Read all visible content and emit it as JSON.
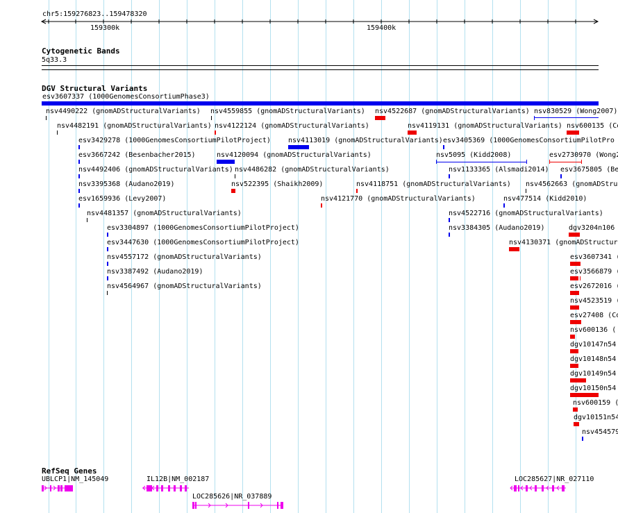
{
  "ruler": {
    "range_label": "chr5:159276823..159478320",
    "ticks": [
      "159300k",
      "159400k"
    ]
  },
  "cytoband": {
    "title": "Cytogenetic Bands",
    "band": "5q33.3"
  },
  "dgv": {
    "title": "DGV Structural Variants",
    "top_label": "esv3607337 (1000GenomesConsortiumPhase3)",
    "items": [
      {
        "id": "nsv4490222",
        "text": "nsv4490222 (gnomADStructuralVariants)",
        "color": "#000000"
      },
      {
        "id": "nsv4559855",
        "text": "nsv4559855 (gnomADStructuralVariants)",
        "color": "#000000"
      },
      {
        "id": "nsv4522687",
        "text": "nsv4522687 (gnomADStructuralVariants)",
        "color": "#ee0000"
      },
      {
        "id": "nsv830529",
        "text": "nsv830529 (Wong2007)",
        "color": "#0000ee"
      },
      {
        "id": "nsv4482191",
        "text": "nsv4482191 (gnomADStructuralVariants)",
        "color": "#000000"
      },
      {
        "id": "nsv4122124",
        "text": "nsv4122124 (gnomADStructuralVariants)",
        "color": "#ee0000"
      },
      {
        "id": "nsv4119131",
        "text": "nsv4119131 (gnomADStructuralVariants)",
        "color": "#ee0000"
      },
      {
        "id": "nsv600135",
        "text": "nsv600135 (Co",
        "color": "#ee0000"
      },
      {
        "id": "esv3429278",
        "text": "esv3429278 (1000GenomesConsortiumPilotProject)",
        "color": "#0000ee"
      },
      {
        "id": "nsv4113019",
        "text": "nsv4113019 (gnomADStructuralVariants)",
        "color": "#0000ee"
      },
      {
        "id": "esv3405369",
        "text": "esv3405369 (1000GenomesConsortiumPilotPro",
        "color": "#0000ee"
      },
      {
        "id": "esv3667242",
        "text": "esv3667242 (Besenbacher2015)",
        "color": "#0000ee"
      },
      {
        "id": "nsv4120094",
        "text": "nsv4120094 (gnomADStructuralVariants)",
        "color": "#0000ee"
      },
      {
        "id": "nsv5095",
        "text": "nsv5095 (Kidd2008)",
        "color": "#0000ee"
      },
      {
        "id": "esv2730970",
        "text": "esv2730970 (Wong2",
        "color": "#ee0000"
      },
      {
        "id": "nsv4492406",
        "text": "nsv4492406 (gnomADStructuralVariants)",
        "color": "#0000ee"
      },
      {
        "id": "nsv4486282",
        "text": "nsv4486282 (gnomADStructuralVariants)",
        "color": "#000000"
      },
      {
        "id": "nsv1133365",
        "text": "nsv1133365 (Alsmadi2014)",
        "color": "#0000ee"
      },
      {
        "id": "esv3675805",
        "text": "esv3675805 (Be",
        "color": "#0000ee"
      },
      {
        "id": "nsv3395368",
        "text": "nsv3395368 (Audano2019)",
        "color": "#0000ee"
      },
      {
        "id": "nsv522395",
        "text": "nsv522395 (Shaikh2009)",
        "color": "#ee0000"
      },
      {
        "id": "nsv4118751",
        "text": "nsv4118751 (gnomADStructuralVariants)",
        "color": "#ee0000"
      },
      {
        "id": "nsv4562663",
        "text": "nsv4562663 (gnomADStru",
        "color": "#000000"
      },
      {
        "id": "esv1659936",
        "text": "esv1659936 (Levy2007)",
        "color": "#0000ee"
      },
      {
        "id": "nsv4121770",
        "text": "nsv4121770 (gnomADStructuralVariants)",
        "color": "#ee0000"
      },
      {
        "id": "nsv477514",
        "text": "nsv477514 (Kidd2010)",
        "color": "#0000ee"
      },
      {
        "id": "nsv4481357",
        "text": "nsv4481357 (gnomADStructuralVariants)",
        "color": "#000000"
      },
      {
        "id": "nsv4522716",
        "text": "nsv4522716 (gnomADStructuralVariants)",
        "color": "#0000ee"
      },
      {
        "id": "esv3304897",
        "text": "esv3304897 (1000GenomesConsortiumPilotProject)",
        "color": "#0000ee"
      },
      {
        "id": "nsv3384305",
        "text": "nsv3384305 (Audano2019)",
        "color": "#0000ee"
      },
      {
        "id": "dgv3204n106",
        "text": "dgv3204n106",
        "color": "#ee0000"
      },
      {
        "id": "esv3447630",
        "text": "esv3447630 (1000GenomesConsortiumPilotProject)",
        "color": "#0000ee"
      },
      {
        "id": "nsv4130371",
        "text": "nsv4130371 (gnomADStructura",
        "color": "#ee0000"
      },
      {
        "id": "nsv4557172",
        "text": "nsv4557172 (gnomADStructuralVariants)",
        "color": "#0000ee"
      },
      {
        "id": "esv3607341",
        "text": "esv3607341 (",
        "color": "#ee0000"
      },
      {
        "id": "nsv3387492",
        "text": "nsv3387492 (Audano2019)",
        "color": "#0000ee"
      },
      {
        "id": "esv3566879",
        "text": "esv3566879 (",
        "color": "#ee0000"
      },
      {
        "id": "nsv4564967",
        "text": "nsv4564967 (gnomADStructuralVariants)",
        "color": "#000000"
      },
      {
        "id": "esv2672016",
        "text": "esv2672016 (C",
        "color": "#ee0000"
      },
      {
        "id": "nsv4523519",
        "text": "nsv4523519 (",
        "color": "#ee0000"
      },
      {
        "id": "esv27408",
        "text": "esv27408 (Co",
        "color": "#ee0000"
      },
      {
        "id": "nsv600136",
        "text": "nsv600136 (",
        "color": "#ee0000"
      },
      {
        "id": "dgv10147n54",
        "text": "dgv10147n54",
        "color": "#ee0000"
      },
      {
        "id": "dgv10148n54",
        "text": "dgv10148n54",
        "color": "#ee0000"
      },
      {
        "id": "dgv10149n54",
        "text": "dgv10149n54",
        "color": "#ee0000"
      },
      {
        "id": "dgv10150n54",
        "text": "dgv10150n54",
        "color": "#ee0000"
      },
      {
        "id": "nsv600159",
        "text": "nsv600159 (",
        "color": "#ee0000"
      },
      {
        "id": "dgv10151n54",
        "text": "dgv10151n54",
        "color": "#ee0000"
      },
      {
        "id": "nsv454579",
        "text": "nsv454579",
        "color": "#0000ee"
      }
    ]
  },
  "refseq": {
    "title": "RefSeq Genes",
    "color": "#ee00ee",
    "genes": [
      {
        "id": "UBLCP1",
        "text": "UBLCP1|NM_145049"
      },
      {
        "id": "IL12B",
        "text": "IL12B|NM_002187"
      },
      {
        "id": "LOC285626",
        "text": "LOC285626|NR_037889"
      },
      {
        "id": "LOC285627",
        "text": "LOC285627|NR_027110"
      }
    ]
  }
}
